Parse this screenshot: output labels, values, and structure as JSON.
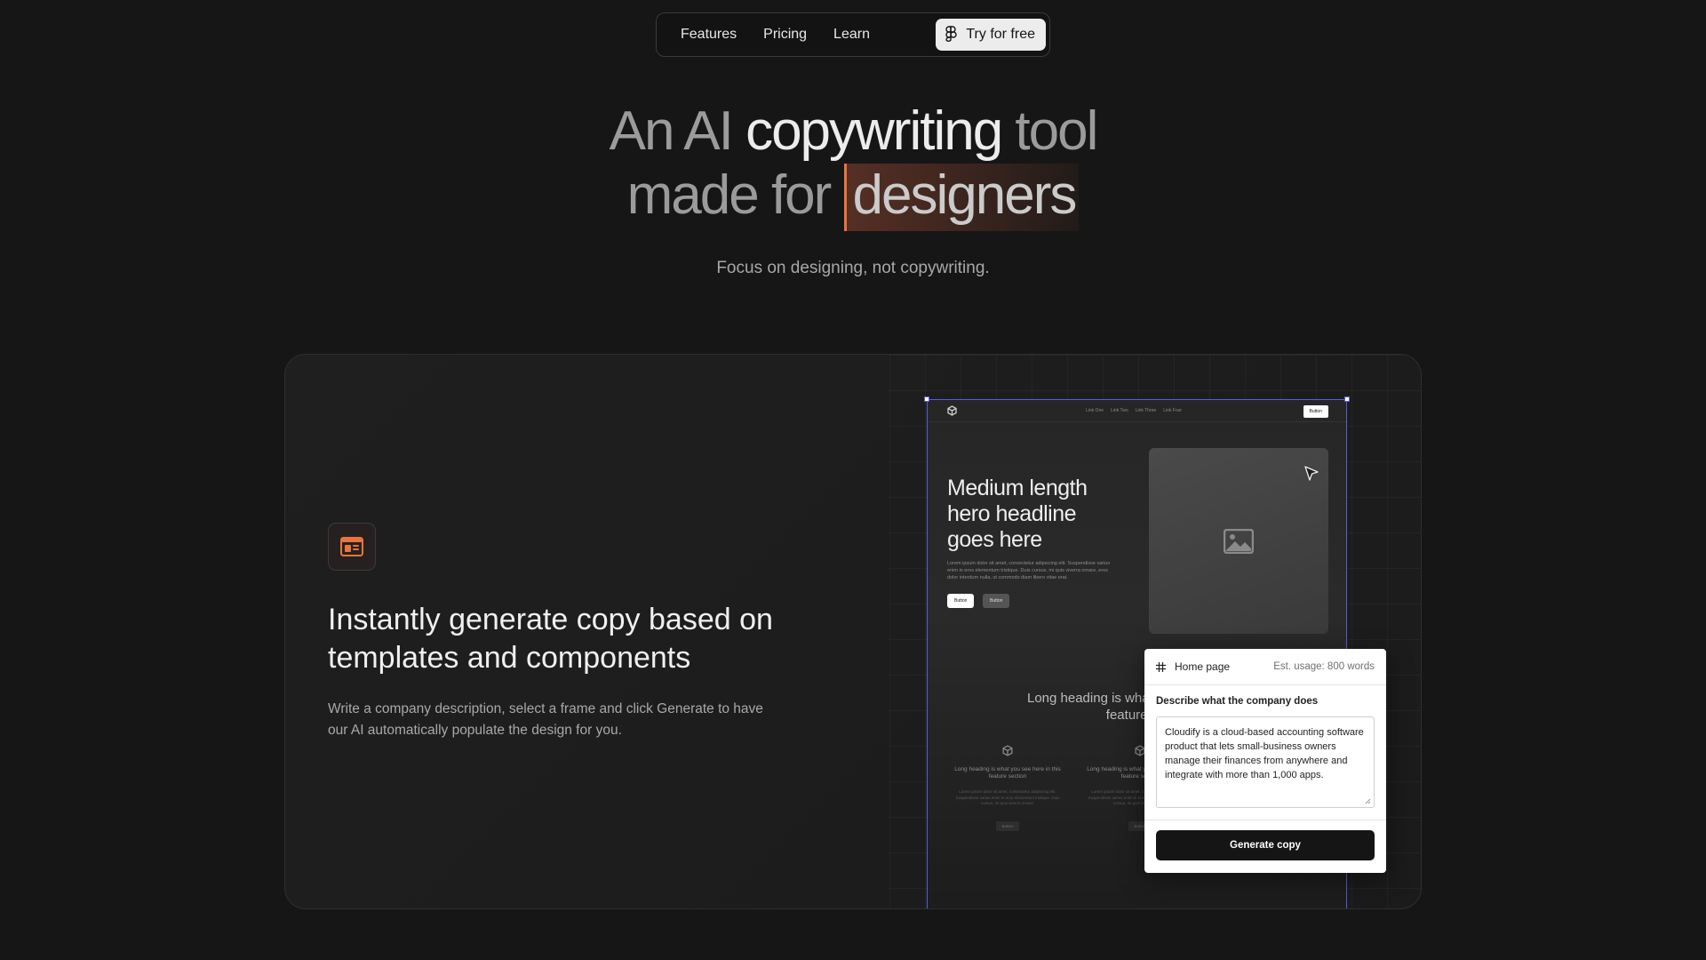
{
  "nav": {
    "items": [
      "Features",
      "Pricing",
      "Learn"
    ],
    "cta_label": "Try for free",
    "cta_icon": "figma-icon"
  },
  "hero": {
    "line1_dim": "An AI",
    "line1_bright": "copywriting",
    "line1_end": "tool",
    "line2_start": "made for",
    "line2_highlight": "designers",
    "subtitle": "Focus on designing, not copywriting."
  },
  "feature": {
    "icon": "template-icon",
    "title": "Instantly generate copy based on templates and components",
    "description": "Write a company description, select a frame and click Generate to have our AI automatically populate the design for you."
  },
  "mock": {
    "links": [
      "Link One",
      "Link Two",
      "Link Three",
      "Link Four"
    ],
    "nav_button": "Button",
    "headline": "Medium length hero headline goes here",
    "paragraph": "Lorem ipsum dolor sit amet, consectetur adipiscing elit. Suspendisse varius enim in eros elementum tristique. Duis cursus, mi quis viverra ornare, eros dolor interdum nulla, ut commodo diam libero vitae erat.",
    "button1": "Button",
    "button2": "Button",
    "heading2": "Long heading is what you see here in this feature section",
    "col_title": "Long heading is what you see here in this feature section",
    "col_text": "Lorem ipsum dolor sit amet, consectetur adipiscing elit. Suspendisse varius enim in eros elementum tristique. Duis cursus, mi quis viverra ornare.",
    "col_button": "Button"
  },
  "panel": {
    "page_name": "Home page",
    "usage": "Est. usage: 800 words",
    "label": "Describe what the company does",
    "textarea_value": "Cloudify is a cloud-based accounting software product that lets small-business owners manage their finances from anywhere and integrate with more than 1,000 apps.",
    "button": "Generate copy"
  },
  "colors": {
    "accent": "#e8743f",
    "selection": "#5b5bdd",
    "background": "#161616"
  }
}
